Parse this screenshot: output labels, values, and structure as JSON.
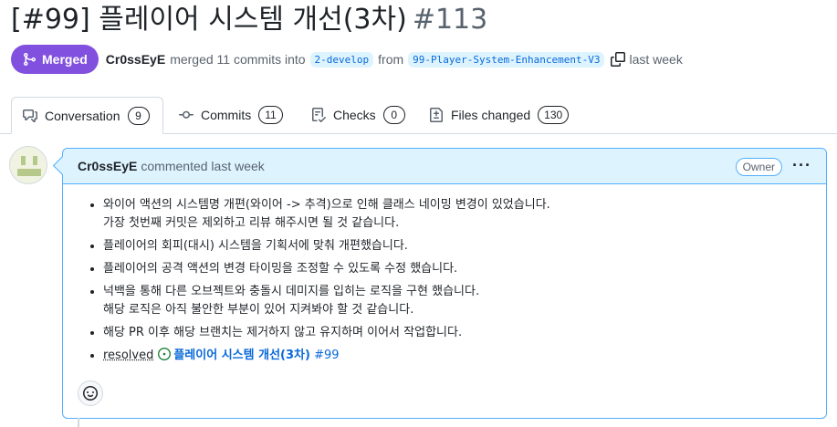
{
  "pr": {
    "title": "[#99] 플레이어 시스템 개선(3차)",
    "number": "#113",
    "state_label": "Merged",
    "author": "Cr0ssEyE",
    "merge_text": "merged 11 commits into",
    "base_branch": "2-develop",
    "from_text": "from",
    "head_branch": "99-Player-System-Enhancement-V3",
    "time": "last week",
    "colors": {
      "merged": "#8250df",
      "link": "#0969da",
      "open_issue": "#1a7f37"
    }
  },
  "tabs": [
    {
      "label": "Conversation",
      "count": "9",
      "icon": "comment-discussion-icon"
    },
    {
      "label": "Commits",
      "count": "11",
      "icon": "git-commit-icon"
    },
    {
      "label": "Checks",
      "count": "0",
      "icon": "checklist-icon"
    },
    {
      "label": "Files changed",
      "count": "130",
      "icon": "file-diff-icon"
    }
  ],
  "comment": {
    "author": "Cr0ssEyE",
    "action": "commented last week",
    "badge": "Owner",
    "items": [
      {
        "line1": "와이어 액션의 시스템명 개편(와이어 -> 추격)으로 인해 클래스 네이밍 변경이 있었습니다.",
        "line2": "가장 첫번째 커밋은 제외하고 리뷰 해주시면 될 것 같습니다."
      },
      {
        "line1": "플레이어의 회피(대시) 시스템을 기획서에 맞춰 개편했습니다."
      },
      {
        "line1": "플레이어의 공격 액션의 변경 타이밍을 조정할 수 있도록 수정 했습니다."
      },
      {
        "line1": "넉백을 통해 다른 오브젝트와 충돌시 데미지를 입히는 로직을 구현 했습니다.",
        "line2": "해당 로직은 아직 불안한 부분이 있어 지켜봐야 할 것 같습니다."
      },
      {
        "line1": "해당 PR 이후 해당 브랜치는 제거하지 않고 유지하며 이어서 작업합니다."
      }
    ],
    "resolved_label": "resolved",
    "issue_title": "플레이어 시스템 개선(3차)",
    "issue_number": "#99"
  }
}
